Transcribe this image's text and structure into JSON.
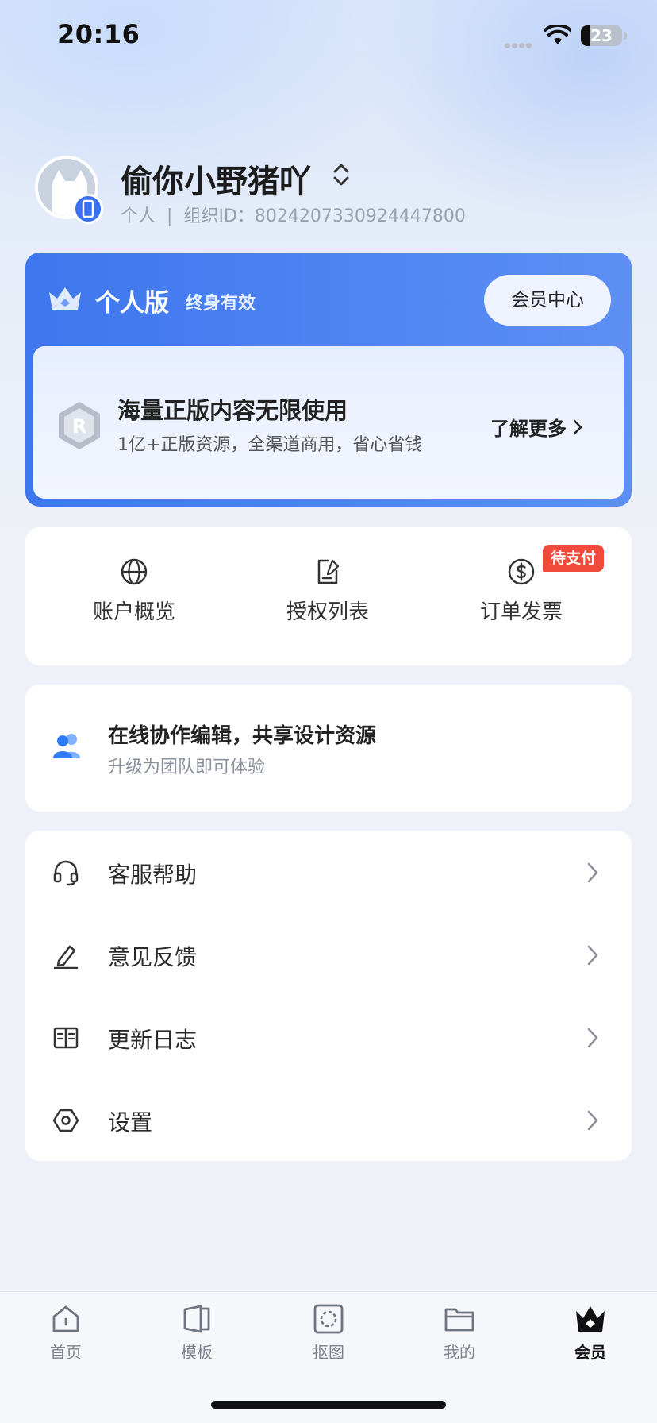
{
  "status_bar": {
    "time": "20:16",
    "battery_percent": "23",
    "battery_level": 0.23
  },
  "profile": {
    "username": "偷你小野猪吖",
    "account_type": "个人",
    "separator": "|",
    "org_id_label": "组织ID：",
    "org_id": "8024207330924447800"
  },
  "vip": {
    "plan_name": "个人版",
    "plan_term": "终身有效",
    "center_button": "会员中心",
    "benefit_title": "海量正版内容无限使用",
    "benefit_desc": "1亿+正版资源，全渠道商用，省心省钱",
    "learn_more": "了解更多",
    "r_letter": "R"
  },
  "quick_actions": [
    {
      "label": "账户概览",
      "icon": "globe-icon"
    },
    {
      "label": "授权列表",
      "icon": "license-doc-icon"
    },
    {
      "label": "订单发票",
      "icon": "dollar-icon",
      "badge": "待支付"
    }
  ],
  "collab": {
    "title": "在线协作编辑，共享设计资源",
    "subtitle": "升级为团队即可体验"
  },
  "menu": [
    {
      "label": "客服帮助",
      "icon": "headset-icon"
    },
    {
      "label": "意见反馈",
      "icon": "edit-pen-icon"
    },
    {
      "label": "更新日志",
      "icon": "book-icon"
    },
    {
      "label": "设置",
      "icon": "hexagon-settings-icon"
    }
  ],
  "tabs": [
    {
      "label": "首页",
      "icon": "home-icon"
    },
    {
      "label": "模板",
      "icon": "template-icon"
    },
    {
      "label": "抠图",
      "icon": "cutout-icon"
    },
    {
      "label": "我的",
      "icon": "folder-icon"
    },
    {
      "label": "会员",
      "icon": "crown-icon",
      "active": true
    }
  ],
  "colors": {
    "accent": "#3e76ee",
    "badge_red": "#ef4a3a",
    "page_bg": "#eef1f7"
  }
}
